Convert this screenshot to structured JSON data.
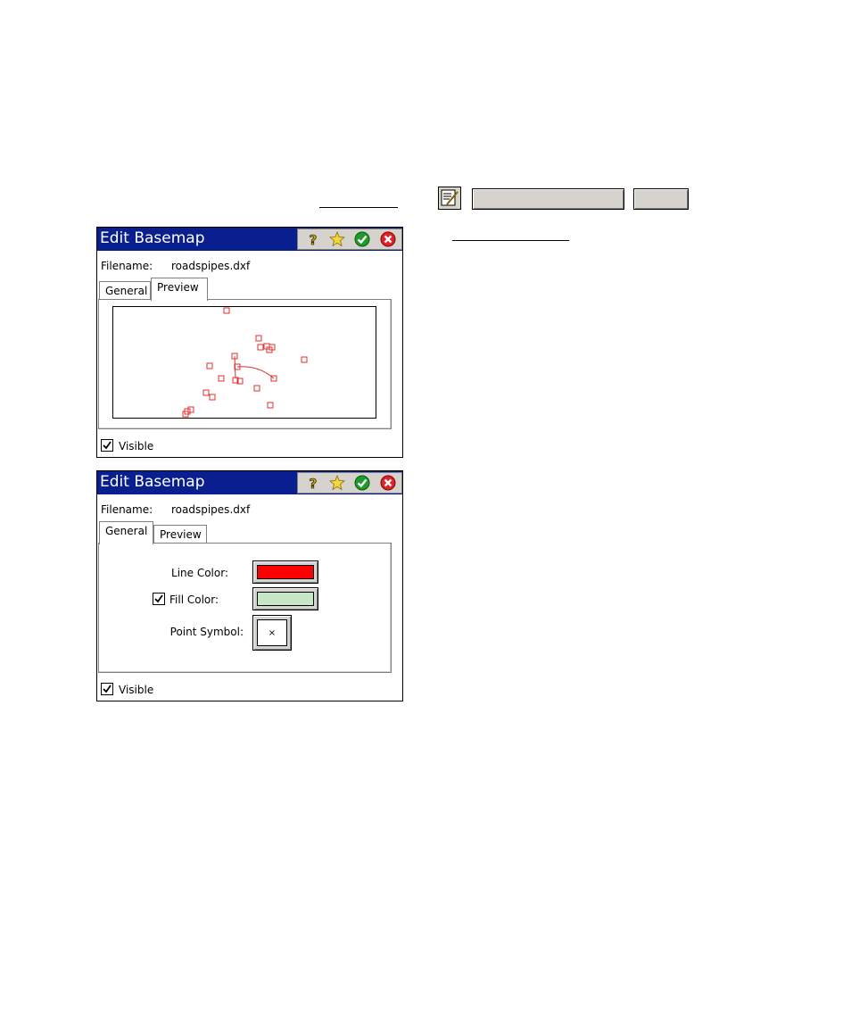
{
  "colors": {
    "title_bar": "#0a1f8f",
    "line_color": "#ff0000",
    "fill_color": "#c6e6c8",
    "map_marker": "#e03030"
  },
  "windows": [
    {
      "title": "Edit Basemap",
      "filename_label": "Filename:",
      "filename_value": "roadspipes.dxf",
      "tabs": [
        {
          "label": "General",
          "active": false
        },
        {
          "label": "Preview",
          "active": true
        }
      ],
      "visible_label": "Visible",
      "visible_checked": true
    },
    {
      "title": "Edit Basemap",
      "filename_label": "Filename:",
      "filename_value": "roadspipes.dxf",
      "tabs": [
        {
          "label": "General",
          "active": true
        },
        {
          "label": "Preview",
          "active": false
        }
      ],
      "line_color_label": "Line Color:",
      "fill_color_label": "Fill Color:",
      "fill_color_checked": true,
      "point_symbol_label": "Point Symbol:",
      "point_symbol_value": "×",
      "visible_label": "Visible",
      "visible_checked": true
    }
  ],
  "titlebar_icons": [
    "help-icon",
    "favorite-star-icon",
    "ok-check-icon",
    "close-x-icon"
  ]
}
